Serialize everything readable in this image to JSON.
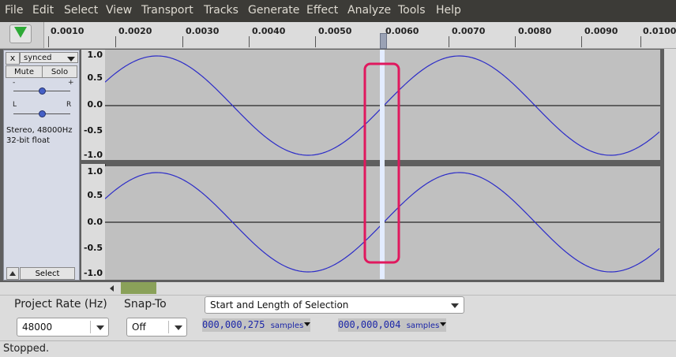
{
  "menu": [
    "File",
    "Edit",
    "Select",
    "View",
    "Transport",
    "Tracks",
    "Generate",
    "Effect",
    "Analyze",
    "Tools",
    "Help"
  ],
  "ruler": {
    "ticks": [
      "0.0010",
      "0.0020",
      "0.0030",
      "0.0040",
      "0.0050",
      "0.0060",
      "0.0070",
      "0.0080",
      "0.0090",
      "0.0100"
    ]
  },
  "track": {
    "name": "synced",
    "close_label": "x",
    "mute_label": "Mute",
    "solo_label": "Solo",
    "gain_minus": "-",
    "gain_plus": "+",
    "pan_left": "L",
    "pan_right": "R",
    "info_line1": "Stereo, 48000Hz",
    "info_line2": "32-bit float",
    "select_label": "Select",
    "scale_labels": [
      "1.0",
      "0.5",
      "0.0",
      "-0.5",
      "-1.0"
    ]
  },
  "selection_bar": {
    "project_rate_label": "Project Rate (Hz)",
    "project_rate_value": "48000",
    "snap_to_label": "Snap-To",
    "snap_to_value": "Off",
    "selection_mode": "Start and Length of Selection",
    "start_digits": "000,000,275",
    "length_digits": "000,000,004",
    "units": "samples"
  },
  "status": "Stopped.",
  "colors": {
    "waveform": "#2c2cc8",
    "wave_bg": "#c0c0c0",
    "play_green": "#2eaa37",
    "annotation_pink": "#e0185e",
    "annotation_red": "#e01010",
    "time_digits": "#1b26a8"
  }
}
